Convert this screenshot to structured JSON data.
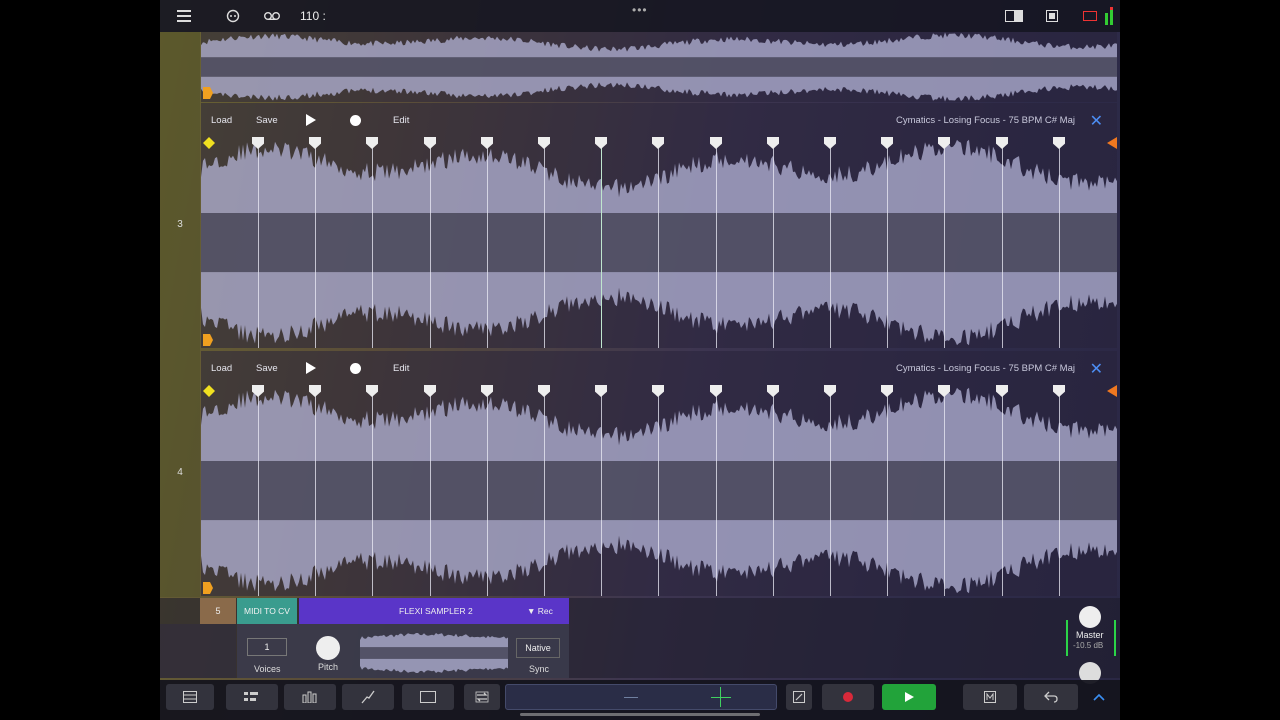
{
  "topbar": {
    "menu_icon": "hamburger-icon",
    "link_icon": "link-icon",
    "loop_icon": "tape-icon",
    "tempo": "110 :",
    "handle": "•••"
  },
  "tracks": [
    {
      "number": "3",
      "load": "Load",
      "save": "Save",
      "edit": "Edit",
      "sample": "Cymatics - Losing Focus - 75 BPM C# Maj"
    },
    {
      "number": "4",
      "load": "Load",
      "save": "Save",
      "edit": "Edit",
      "sample": "Cymatics - Losing Focus - 75 BPM C# Maj"
    }
  ],
  "bottom": {
    "track_number": "5",
    "midi_label": "MIDI TO CV",
    "device_name": "FLEXI SAMPLER 2",
    "rec_label": "▼ Rec",
    "voices_value": "1",
    "voices_label": "Voices",
    "pitch_label": "Pitch",
    "native_label": "Native",
    "sync_label": "Sync",
    "master_label": "Master",
    "master_db": "-10.5 dB"
  },
  "colors": {
    "accent": "#4c8df3",
    "play_green": "#22a33a",
    "record_red": "#d8293a",
    "midi_teal": "#3a9c8e",
    "device_purple": "#5a35c8"
  }
}
